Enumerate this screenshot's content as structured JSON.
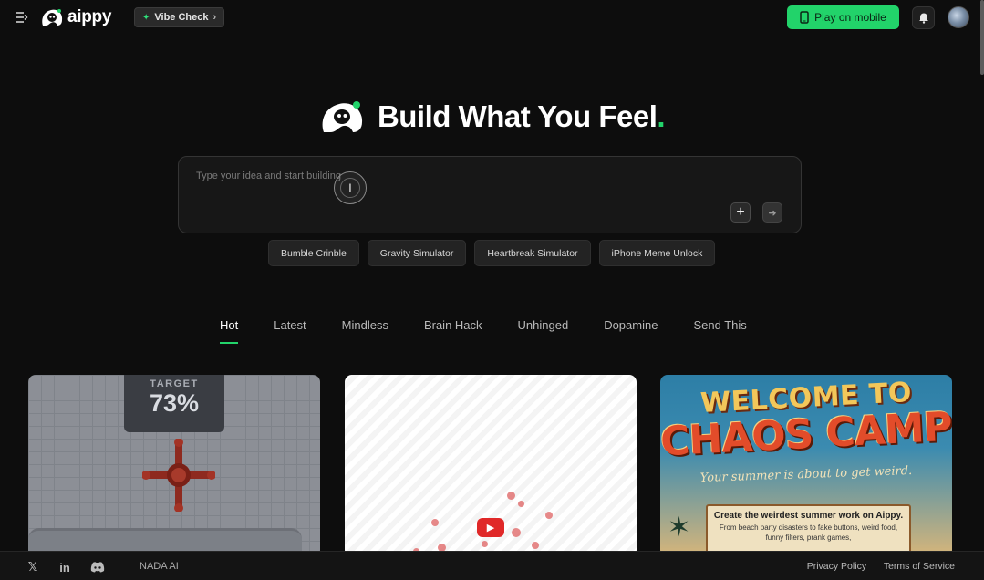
{
  "header": {
    "logo_text": "aippy",
    "vibe_label": "Vibe Check",
    "play_label": "Play on mobile",
    "icons": [
      "menu-icon",
      "bell-icon",
      "phone-icon",
      "sparkle-icon",
      "chevron-right-icon"
    ]
  },
  "hero": {
    "title": "Build What You Feel",
    "dot": "."
  },
  "prompt": {
    "placeholder": "Type your idea and start building",
    "plus_symbol": "+",
    "send_symbol": "➜"
  },
  "chips": [
    "Bumble Crinble",
    "Gravity Simulator",
    "Heartbreak Simulator",
    "iPhone Meme Unlock"
  ],
  "tabs": [
    {
      "label": "Hot",
      "active": true
    },
    {
      "label": "Latest",
      "active": false
    },
    {
      "label": "Mindless",
      "active": false
    },
    {
      "label": "Brain Hack",
      "active": false
    },
    {
      "label": "Unhinged",
      "active": false
    },
    {
      "label": "Dopamine",
      "active": false
    },
    {
      "label": "Send This",
      "active": false
    }
  ],
  "cards": {
    "card1": {
      "target_label": "TARGET",
      "target_value": "73%"
    },
    "card3": {
      "line1": "WELCOME TO",
      "line2": "CHAOS CAMP",
      "tagline": "Your summer is about to get weird.",
      "box_title": "Create the weirdest summer work on Aippy.",
      "box_body": "From beach party disasters to fake buttons, weird food, funny filters, prank games,"
    }
  },
  "footer": {
    "company": "NADA AI",
    "privacy": "Privacy Policy",
    "separator": "|",
    "terms": "Terms of Service",
    "icons": [
      "x-icon",
      "linkedin-icon",
      "discord-icon"
    ]
  },
  "colors": {
    "accent": "#22d36a",
    "background": "#0d0d0d"
  }
}
